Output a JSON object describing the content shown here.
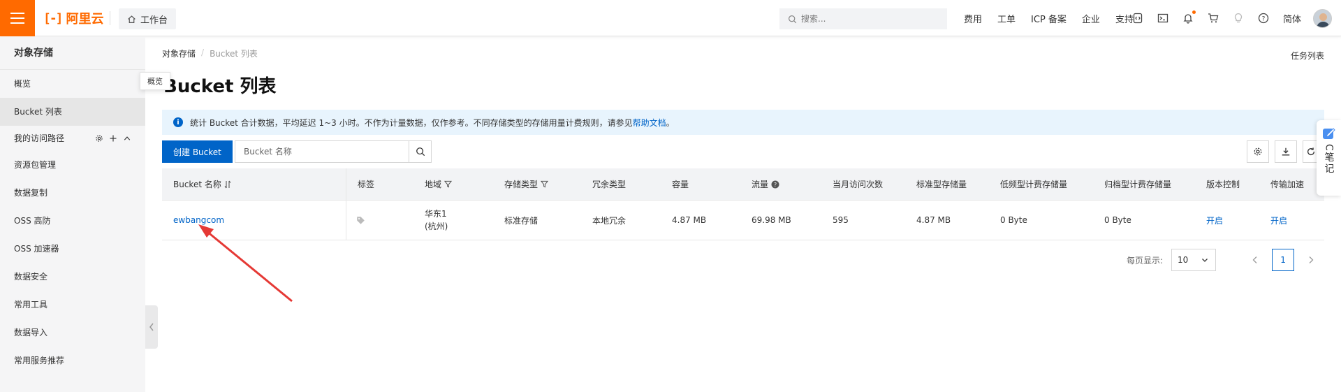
{
  "topbar": {
    "logo_mark": "[-]",
    "logo_text": "阿里云",
    "workbench_label": "工作台",
    "search_placeholder": "搜索...",
    "links": [
      "费用",
      "工单",
      "ICP 备案",
      "企业",
      "支持"
    ],
    "language": "简体",
    "accent_color": "#ff6a00"
  },
  "sidebar": {
    "title": "对象存储",
    "items": [
      {
        "label": "概览"
      },
      {
        "label": "Bucket 列表",
        "active": true
      },
      {
        "label": "我的访问路径"
      },
      {
        "label": "资源包管理"
      },
      {
        "label": "数据复制"
      },
      {
        "label": "OSS 高防"
      },
      {
        "label": "OSS 加速器"
      },
      {
        "label": "数据安全"
      },
      {
        "label": "常用工具"
      },
      {
        "label": "数据导入"
      },
      {
        "label": "常用服务推荐"
      }
    ],
    "tooltip": "概览"
  },
  "breadcrumb": [
    "对象存储",
    "Bucket 列表"
  ],
  "task_list_label": "任务列表",
  "page_title": "Bucket 列表",
  "notice": {
    "text": "统计 Bucket 合计数据，平均延迟 1~3 小时。不作为计量数据，仅作参考。不同存储类型的存储用量计费规则，请参见",
    "link": "帮助文档",
    "tail": "。"
  },
  "toolbar": {
    "create_label": "创建 Bucket",
    "search_placeholder": "Bucket 名称"
  },
  "table": {
    "headers": [
      "Bucket 名称",
      "标签",
      "地域",
      "存储类型",
      "冗余类型",
      "容量",
      "流量",
      "当月访问次数",
      "标准型存储量",
      "低频型计费存储量",
      "归档型计费存储量",
      "版本控制",
      "传输加速"
    ],
    "rows": [
      {
        "name": "ewbangcom",
        "region_line1": "华东1",
        "region_line2": "(杭州)",
        "storage_type": "标准存储",
        "redundancy": "本地冗余",
        "capacity": "4.87 MB",
        "traffic": "69.98 MB",
        "monthly_visits": "595",
        "standard_storage": "4.87 MB",
        "ia_storage": "0 Byte",
        "archive_storage": "0 Byte",
        "versioning": "开启",
        "acceleration": "开启"
      }
    ]
  },
  "pagination": {
    "page_size_label": "每页显示:",
    "page_size": "10",
    "current_page": "1"
  },
  "notes_widget": {
    "label": "C笔记"
  }
}
